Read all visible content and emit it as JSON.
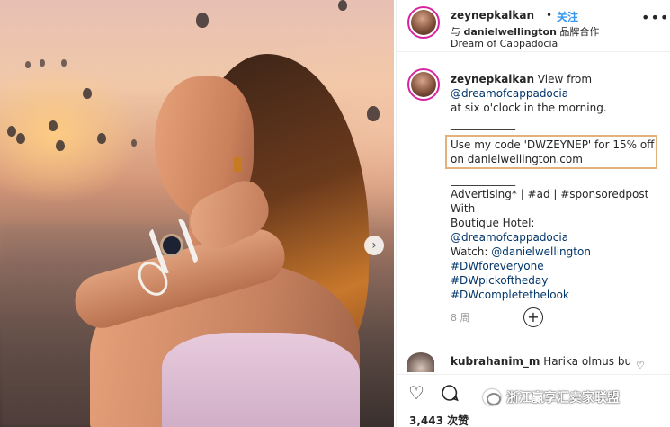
{
  "header": {
    "username": "zeynepkalkan",
    "dot": "•",
    "follow_label": "关注",
    "partner_prefix": "与",
    "partner_name": "danielwellington",
    "partner_suffix": "品牌合作",
    "location": "Dream of Cappadocia",
    "more_icon": "more-horizontal-icon"
  },
  "caption": {
    "username": "zeynepkalkan",
    "text_1": "View from",
    "mention_1": "@dreamofcappadocia",
    "text_2": "at six o'clock in the morning.",
    "divider_1": "____________",
    "promo_line_1": "Use my code 'DWZEYNEP' for 15% off",
    "promo_line_2": "on danielwellington.com",
    "divider_2": "____________",
    "ad_line": "Advertising* | #ad | #sponsoredpost",
    "with_label": "With",
    "hotel_label": "Boutique Hotel:",
    "mention_2": "@dreamofcappadocia",
    "watch_label": "Watch:",
    "mention_3": "@danielwellington",
    "hashtag_1": "#DWforeveryone",
    "hashtag_2": "#DWpickoftheday",
    "hashtag_3": "#DWcompletethelook",
    "time_ago": "8 周"
  },
  "load_more_icon": "plus-circle-icon",
  "comment": {
    "username": "kubrahanim_m",
    "text": "Harika olmus bu"
  },
  "actions": {
    "like_icon": "heart-icon",
    "comment_icon": "comment-icon",
    "likes": "3,443 次赞"
  },
  "watermark": {
    "text": "浙江赢享汇卖家联盟"
  },
  "photo": {
    "next_icon": "chevron-right-icon",
    "next_glyph": "›"
  }
}
